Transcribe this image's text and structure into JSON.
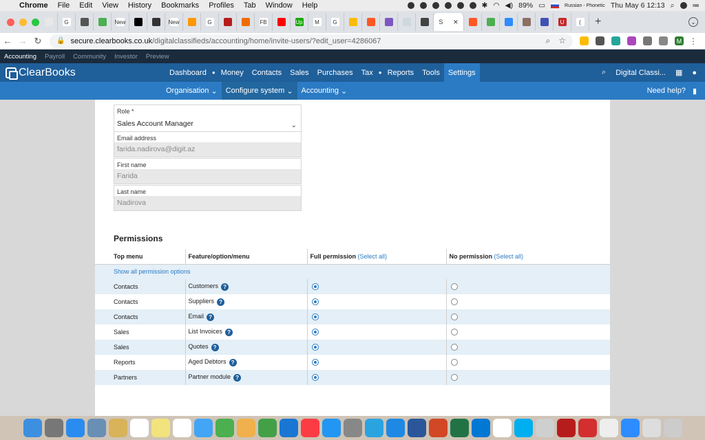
{
  "menubar": {
    "apple": "",
    "items": [
      "Chrome",
      "File",
      "Edit",
      "View",
      "History",
      "Bookmarks",
      "Profiles",
      "Tab",
      "Window",
      "Help"
    ],
    "battery": "89%",
    "input_source": "Russian - Phonetic",
    "clock": "Thu May 6  12:13"
  },
  "browser": {
    "tabs": [
      {
        "label": "",
        "color": "#e8e8e8"
      },
      {
        "label": "G",
        "color": "#ffffff"
      },
      {
        "label": "",
        "color": "#555555"
      },
      {
        "label": "",
        "color": "#4caf50"
      },
      {
        "label": "New",
        "color": "#ffffff"
      },
      {
        "label": "",
        "color": "#000000"
      },
      {
        "label": "",
        "color": "#333333"
      },
      {
        "label": "New",
        "color": "#ffffff"
      },
      {
        "label": "",
        "color": "#ff9800"
      },
      {
        "label": "G",
        "color": "#ffffff"
      },
      {
        "label": "",
        "color": "#b71c1c"
      },
      {
        "label": "",
        "color": "#ef6c00"
      },
      {
        "label": "FB",
        "color": "#ffffff"
      },
      {
        "label": "",
        "color": "#ff0000"
      },
      {
        "label": "Up",
        "color": "#14a800"
      },
      {
        "label": "M",
        "color": "#ffffff"
      },
      {
        "label": "G",
        "color": "#ffffff"
      },
      {
        "label": "",
        "color": "#fbbc05"
      },
      {
        "label": "",
        "color": "#ff5722"
      },
      {
        "label": "",
        "color": "#7e57c2"
      },
      {
        "label": "",
        "color": "#cfd8dc"
      },
      {
        "label": "",
        "color": "#424242"
      }
    ],
    "active_tab_label": "S",
    "tabs_after": [
      {
        "label": "",
        "color": "#ff5722"
      },
      {
        "label": "",
        "color": "#4caf50"
      },
      {
        "label": "",
        "color": "#2d8cff"
      },
      {
        "label": "",
        "color": "#8d6e63"
      },
      {
        "label": "",
        "color": "#3f51b5"
      },
      {
        "label": "U",
        "color": "#c62828"
      },
      {
        "label": "(",
        "color": "#ffffff"
      }
    ],
    "url_host": "secure.clearbooks.co.uk",
    "url_path": "/digitalclassifieds/accounting/home/invite-users/?edit_user=4286067",
    "profile_initial": "M"
  },
  "app_strip": {
    "items": [
      "Accounting",
      "Payroll",
      "Community",
      "Investor",
      "Preview"
    ],
    "active": "Accounting"
  },
  "header": {
    "logo": "ClearBooks",
    "nav": [
      "Dashboard",
      "Money",
      "Contacts",
      "Sales",
      "Purchases",
      "Tax",
      "Reports",
      "Tools",
      "Settings"
    ],
    "active": "Settings",
    "company": "Digital Classi..."
  },
  "subnav": {
    "items": [
      "Organisation",
      "Configure system",
      "Accounting"
    ],
    "active": "Configure system",
    "help": "Need help?"
  },
  "form": {
    "role_label": "Role *",
    "role_value": "Sales Account Manager",
    "email_label": "Email address",
    "email_value": "farida.nadirova@digit.az",
    "first_label": "First name",
    "first_value": "Farida",
    "last_label": "Last name",
    "last_value": "Nadirova"
  },
  "permissions": {
    "title": "Permissions",
    "headers": {
      "top_menu": "Top menu",
      "feature": "Feature/option/menu",
      "full": "Full permission",
      "none": "No permission",
      "select_all": "(Select all)"
    },
    "show_all": "Show all permission options",
    "rows": [
      {
        "menu": "Contacts",
        "feature": "Customers",
        "full": true
      },
      {
        "menu": "Contacts",
        "feature": "Suppliers",
        "full": true
      },
      {
        "menu": "Contacts",
        "feature": "Email",
        "full": true
      },
      {
        "menu": "Sales",
        "feature": "List Invoices",
        "full": true
      },
      {
        "menu": "Sales",
        "feature": "Quotes",
        "full": true
      },
      {
        "menu": "Reports",
        "feature": "Aged Debtors",
        "full": true
      },
      {
        "menu": "Partners",
        "feature": "Partner module",
        "full": true
      }
    ]
  },
  "dock": {
    "apps": [
      "Finder",
      "Launchpad",
      "Safari",
      "Preview",
      "Notes",
      "Calendar",
      "Stickies",
      "Reminders",
      "Messages",
      "FaceTime",
      "Photos",
      "Numbers",
      "Keynote",
      "Music",
      "App Store",
      "System Preferences",
      "Telegram",
      "Skype for Business",
      "Word",
      "PowerPoint",
      "Excel",
      "Outlook",
      "Chrome",
      "Skype",
      "Script Editor",
      "Acrobat",
      "Reader",
      "Preview Pen",
      "Zoom",
      "Archive",
      "Trash"
    ],
    "colors": [
      "#3d8fe0",
      "#777777",
      "#2a8cf0",
      "#6a8fb5",
      "#d8b35a",
      "#ffffff",
      "#f2e37c",
      "#ffffff",
      "#42a5f5",
      "#4caf50",
      "#f0b04b",
      "#43a047",
      "#1976d2",
      "#fc3c44",
      "#2196f3",
      "#888888",
      "#2aa4e0",
      "#1e88e5",
      "#2b579a",
      "#d24726",
      "#217346",
      "#0078d4",
      "#ffffff",
      "#00aff0",
      "#cfcfcf",
      "#b71c1c",
      "#d32f2f",
      "#eeeeee",
      "#2d8cff",
      "#dddddd",
      "#cccccc"
    ],
    "calendar_day": "6"
  }
}
